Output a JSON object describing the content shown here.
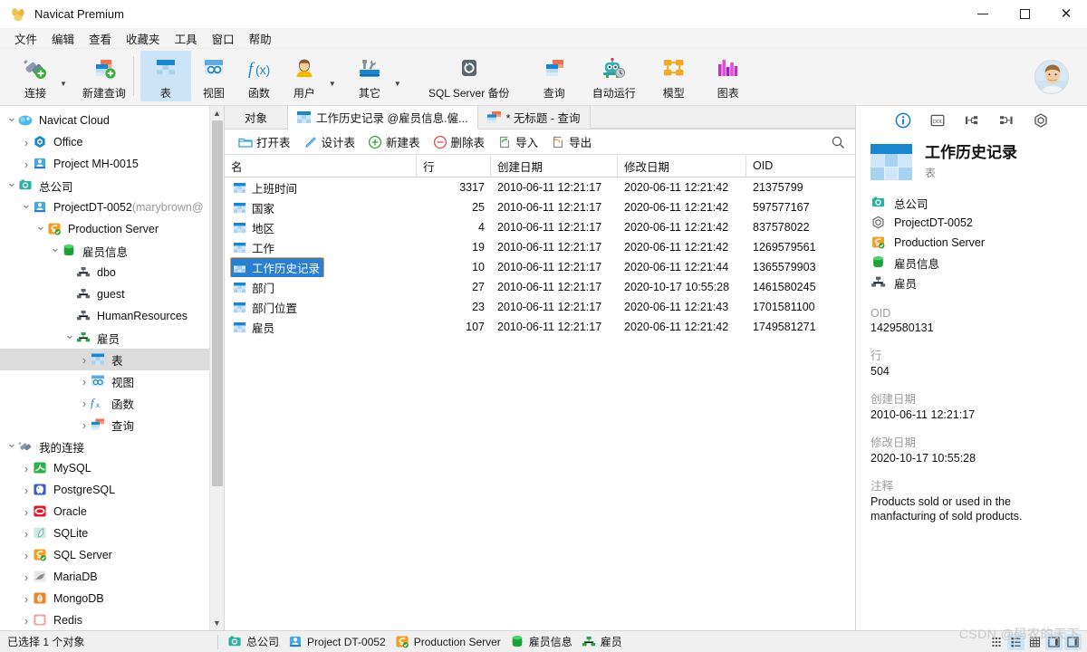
{
  "window": {
    "title": "Navicat Premium",
    "logo_icon": "navicat-logo-icon",
    "minimize_icon": "minimize-icon",
    "maximize_icon": "maximize-icon",
    "close_icon": "close-icon"
  },
  "menubar": {
    "items": [
      {
        "label": "文件"
      },
      {
        "label": "编辑"
      },
      {
        "label": "查看"
      },
      {
        "label": "收藏夹"
      },
      {
        "label": "工具"
      },
      {
        "label": "窗口"
      },
      {
        "label": "帮助"
      }
    ]
  },
  "toolbar": {
    "items": [
      {
        "label": "连接",
        "icon": "connection-plug-icon",
        "dropdown": true,
        "active": false
      },
      {
        "label": "新建查询",
        "icon": "new-query-icon",
        "dropdown": false,
        "active": false
      },
      {
        "label": "表",
        "icon": "table-icon",
        "dropdown": false,
        "active": true
      },
      {
        "label": "视图",
        "icon": "view-icon",
        "dropdown": false,
        "active": false
      },
      {
        "label": "函数",
        "icon": "function-fx-icon",
        "dropdown": false,
        "active": false
      },
      {
        "label": "用户",
        "icon": "user-icon",
        "dropdown": true,
        "active": false
      },
      {
        "label": "其它",
        "icon": "other-tools-icon",
        "dropdown": true,
        "active": false
      },
      {
        "label": "SQL Server 备份",
        "icon": "backup-restore-icon",
        "dropdown": false,
        "active": false
      },
      {
        "label": "查询",
        "icon": "query-icon",
        "dropdown": false,
        "active": false
      },
      {
        "label": "自动运行",
        "icon": "automation-robot-icon",
        "dropdown": false,
        "active": false
      },
      {
        "label": "模型",
        "icon": "model-diagram-icon",
        "dropdown": false,
        "active": false
      },
      {
        "label": "图表",
        "icon": "chart-bars-icon",
        "dropdown": false,
        "active": false
      }
    ],
    "avatar_name": "user-avatar"
  },
  "sidebar": {
    "items": [
      {
        "label": "Navicat Cloud",
        "indent": 0,
        "state": "open",
        "icon": "cloud-icon",
        "selected": false
      },
      {
        "label": "Office",
        "indent": 1,
        "state": "closed",
        "icon": "office-project-icon",
        "selected": false
      },
      {
        "label": "Project MH-0015",
        "indent": 1,
        "state": "closed",
        "icon": "project-icon",
        "selected": false
      },
      {
        "label": "总公司",
        "indent": 0,
        "state": "open",
        "icon": "organization-icon",
        "selected": false
      },
      {
        "label": "ProjectDT-0052",
        "sub": " (marybrown@",
        "indent": 1,
        "state": "open",
        "icon": "project-icon",
        "selected": false
      },
      {
        "label": "Production Server",
        "indent": 2,
        "state": "open",
        "icon": "sqlserver-connection-icon",
        "selected": false
      },
      {
        "label": "雇员信息",
        "indent": 3,
        "state": "open",
        "icon": "database-icon",
        "selected": false
      },
      {
        "label": "dbo",
        "indent": 4,
        "state": "none",
        "icon": "schema-icon",
        "selected": false
      },
      {
        "label": "guest",
        "indent": 4,
        "state": "none",
        "icon": "schema-icon",
        "selected": false
      },
      {
        "label": "HumanResources",
        "indent": 4,
        "state": "none",
        "icon": "schema-icon",
        "selected": false
      },
      {
        "label": "雇员",
        "indent": 4,
        "state": "open",
        "icon": "schema-green-icon",
        "selected": false
      },
      {
        "label": "表",
        "indent": 5,
        "state": "closed",
        "icon": "table-icon",
        "selected": true
      },
      {
        "label": "视图",
        "indent": 5,
        "state": "closed",
        "icon": "view-icon",
        "selected": false
      },
      {
        "label": "函数",
        "indent": 5,
        "state": "closed",
        "icon": "function-fx-icon",
        "selected": false
      },
      {
        "label": "查询",
        "indent": 5,
        "state": "closed",
        "icon": "query-icon",
        "selected": false
      },
      {
        "label": "我的连接",
        "indent": 0,
        "state": "open",
        "icon": "my-connections-icon",
        "selected": false
      },
      {
        "label": "MySQL",
        "indent": 1,
        "state": "closed",
        "icon": "mysql-icon",
        "selected": false
      },
      {
        "label": "PostgreSQL",
        "indent": 1,
        "state": "closed",
        "icon": "postgresql-icon",
        "selected": false
      },
      {
        "label": "Oracle",
        "indent": 1,
        "state": "closed",
        "icon": "oracle-icon",
        "selected": false
      },
      {
        "label": "SQLite",
        "indent": 1,
        "state": "closed",
        "icon": "sqlite-icon",
        "selected": false
      },
      {
        "label": "SQL Server",
        "indent": 1,
        "state": "closed",
        "icon": "sqlserver-icon",
        "selected": false
      },
      {
        "label": "MariaDB",
        "indent": 1,
        "state": "closed",
        "icon": "mariadb-icon",
        "selected": false
      },
      {
        "label": "MongoDB",
        "indent": 1,
        "state": "closed",
        "icon": "mongodb-icon",
        "selected": false
      },
      {
        "label": "Redis",
        "indent": 1,
        "state": "closed",
        "icon": "redis-icon",
        "selected": false
      }
    ]
  },
  "tabs": {
    "object_label": "对象",
    "items": [
      {
        "label": "工作历史记录 @雇员信息.僱...",
        "icon": "table-icon",
        "active": true
      },
      {
        "label": "* 无标题 - 查询",
        "icon": "query-icon",
        "active": false
      }
    ]
  },
  "object_toolbar": {
    "buttons": [
      {
        "label": "打开表",
        "icon": "open-folder-icon"
      },
      {
        "label": "设计表",
        "icon": "pencil-design-icon"
      },
      {
        "label": "新建表",
        "icon": "plus-circle-icon"
      },
      {
        "label": "删除表",
        "icon": "minus-circle-icon"
      },
      {
        "label": "导入",
        "icon": "import-arrow-icon"
      },
      {
        "label": "导出",
        "icon": "export-arrow-icon"
      }
    ],
    "search_icon": "search-icon"
  },
  "grid": {
    "columns": [
      "名",
      "行",
      "创建日期",
      "修改日期",
      "OID"
    ],
    "rows": [
      {
        "name": "上班时间",
        "rows": "3317",
        "created": "2010-06-11 12:21:17",
        "modified": "2020-06-11 12:21:42",
        "oid": "21375799",
        "selected": false
      },
      {
        "name": "国家",
        "rows": "25",
        "created": "2010-06-11 12:21:17",
        "modified": "2020-06-11 12:21:42",
        "oid": "597577167",
        "selected": false
      },
      {
        "name": "地区",
        "rows": "4",
        "created": "2010-06-11 12:21:17",
        "modified": "2020-06-11 12:21:42",
        "oid": "837578022",
        "selected": false
      },
      {
        "name": "工作",
        "rows": "19",
        "created": "2010-06-11 12:21:17",
        "modified": "2020-06-11 12:21:42",
        "oid": "1269579561",
        "selected": false
      },
      {
        "name": "工作历史记录",
        "rows": "10",
        "created": "2010-06-11 12:21:17",
        "modified": "2020-06-11 12:21:44",
        "oid": "1365579903",
        "selected": true
      },
      {
        "name": "部门",
        "rows": "27",
        "created": "2010-06-11 12:21:17",
        "modified": "2020-10-17 10:55:28",
        "oid": "1461580245",
        "selected": false
      },
      {
        "name": "部门位置",
        "rows": "23",
        "created": "2010-06-11 12:21:17",
        "modified": "2020-06-11 12:21:43",
        "oid": "1701581100",
        "selected": false
      },
      {
        "name": "雇员",
        "rows": "107",
        "created": "2010-06-11 12:21:17",
        "modified": "2020-06-11 12:21:42",
        "oid": "1749581271",
        "selected": false
      }
    ]
  },
  "info_panel": {
    "tabs": [
      {
        "icon": "info-circle-icon",
        "active": true
      },
      {
        "icon": "ddl-icon",
        "active": false
      },
      {
        "icon": "er-diagram-icon",
        "active": false
      },
      {
        "icon": "data-structure-icon",
        "active": false
      },
      {
        "icon": "hexagon-settings-icon",
        "active": false
      }
    ],
    "title": "工作历史记录",
    "subtitle": "表",
    "object_icon": "table-large-icon",
    "breadcrumbs": [
      {
        "label": "总公司",
        "icon": "organization-icon"
      },
      {
        "label": "ProjectDT-0052",
        "icon": "hexagon-settings-icon"
      },
      {
        "label": "Production Server",
        "icon": "sqlserver-connection-icon"
      },
      {
        "label": "雇员信息",
        "icon": "database-icon"
      },
      {
        "label": "雇员",
        "icon": "schema-icon"
      }
    ],
    "fields": [
      {
        "label": "OID",
        "value": "1429580131"
      },
      {
        "label": "行",
        "value": "504"
      },
      {
        "label": "创建日期",
        "value": "2010-06-11 12:21:17"
      },
      {
        "label": "修改日期",
        "value": "2020-10-17 10:55:28"
      },
      {
        "label": "注释",
        "value": "Products sold or used in the manfacturing of sold products."
      }
    ]
  },
  "status_bar": {
    "selection": "已选择 1 个对象",
    "path": [
      {
        "label": "总公司",
        "icon": "organization-icon"
      },
      {
        "label": "Project DT-0052",
        "icon": "project-icon"
      },
      {
        "label": "Production Server",
        "icon": "sqlserver-connection-icon"
      },
      {
        "label": "雇员信息",
        "icon": "database-icon"
      },
      {
        "label": "雇员",
        "icon": "schema-green-icon"
      }
    ],
    "view_buttons": [
      {
        "icon": "grid-small-view-icon",
        "active": false
      },
      {
        "icon": "list-detail-view-icon",
        "active": true
      },
      {
        "icon": "grid-large-view-icon",
        "active": false
      },
      {
        "icon": "split-right-panel-icon",
        "active": true
      },
      {
        "icon": "split-bottom-panel-icon",
        "active": true
      }
    ]
  },
  "watermark": "CSDN @码农的天下",
  "colors": {
    "accent": "#0a7bd4",
    "selection": "#2a7fd4",
    "toolbar_bg": "#f4f4f4",
    "tree_sel": "#dcdcdc"
  }
}
